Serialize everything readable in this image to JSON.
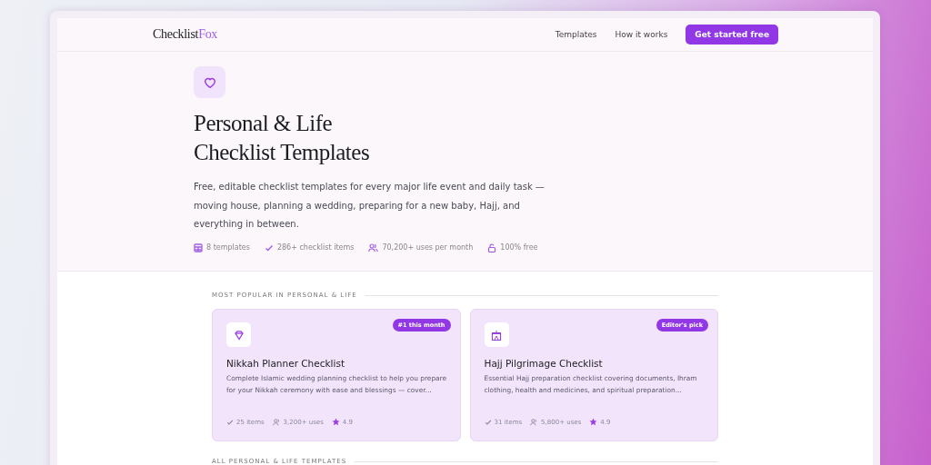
{
  "nav": {
    "logo": {
      "main": "Checklist",
      "accent": "Fox"
    },
    "links": [
      "Templates",
      "How it works"
    ],
    "cta": "Get started free"
  },
  "hero": {
    "title_lines": [
      "Personal & Life",
      "Checklist Templates"
    ],
    "description": "Free, editable checklist templates for every major life event and daily task — moving house, planning a wedding, preparing for a new baby, Hajj, and everything in between.",
    "stats": [
      {
        "kind": "templates",
        "text": "8 templates"
      },
      {
        "kind": "check",
        "text": "286+ checklist items"
      },
      {
        "kind": "users",
        "text": "70,200+ uses per month"
      },
      {
        "kind": "lock",
        "text": "100% free"
      }
    ]
  },
  "popular": {
    "heading": "MOST POPULAR IN PERSONAL & LIFE",
    "cards": [
      {
        "kind": "gem",
        "badge": "#1 this month",
        "title": "Nikkah Planner Checklist",
        "description": "Complete Islamic wedding planning checklist to help you prepare for your Nikkah ceremony with ease and blessings — cover...",
        "items": "25 items",
        "uses": "3,200+ uses",
        "rating": "4.9"
      },
      {
        "kind": "kaaba",
        "badge": "Editor's pick",
        "title": "Hajj Pilgrimage Checklist",
        "description": "Essential Hajj preparation checklist covering documents, Ihram clothing, health and medicines, and spiritual preparation...",
        "items": "31 items",
        "uses": "5,800+ uses",
        "rating": "4.9"
      }
    ]
  },
  "all_heading": "ALL PERSONAL & LIFE TEMPLATES"
}
